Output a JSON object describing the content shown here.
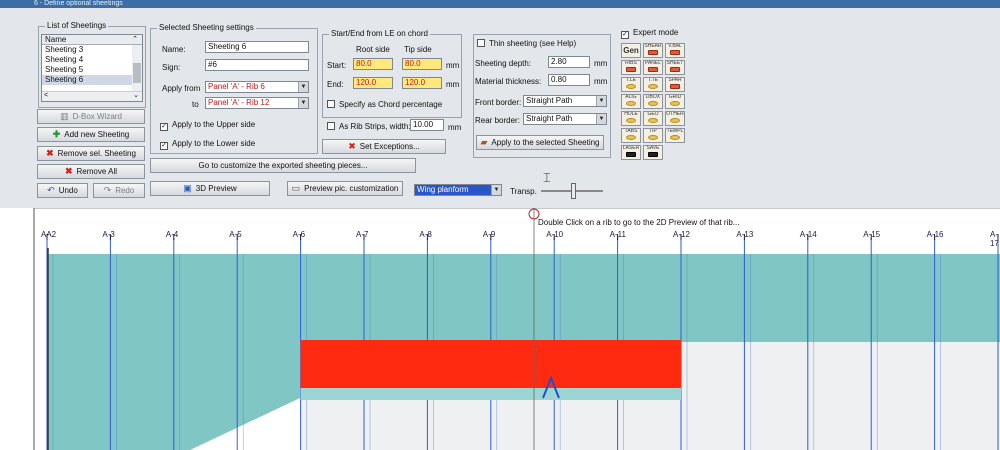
{
  "window": {
    "title": "6 - Define optional sheetings"
  },
  "list": {
    "title": "List of Sheetings",
    "header": "Name",
    "items": [
      "Sheeting 3",
      "Sheeting 4",
      "Sheeting 5",
      "Sheeting 6"
    ],
    "selected_index": 3
  },
  "left_buttons": {
    "dbox": "D-Box Wizard",
    "add": "Add new Sheeting",
    "remove_sel": "Remove sel. Sheeting",
    "remove_all": "Remove All",
    "undo": "Undo",
    "redo": "Redo"
  },
  "settings": {
    "title": "Selected Sheeting settings",
    "name_label": "Name:",
    "name_value": "Sheeting 6",
    "sign_label": "Sign:",
    "sign_value": "#6",
    "apply_from_label": "Apply from",
    "apply_from_value": "Panel 'A' - Rib 6",
    "to_label": "to",
    "to_value": "Panel 'A' - Rib 12",
    "upper_label": "Apply to the Upper side",
    "lower_label": "Apply to the Lower side"
  },
  "startend": {
    "title": "Start/End from LE on chord",
    "root_label": "Root side",
    "tip_label": "Tip side",
    "start_label": "Start:",
    "end_label": "End:",
    "start_root": "80.0",
    "start_tip": "80.0",
    "end_root": "120.0",
    "end_tip": "120.0",
    "unit": "mm",
    "chord_pct_label": "Specify as Chord percentage",
    "rib_strips_label": "As Rib Strips, width:",
    "rib_strips_value": "10.00",
    "rib_strips_unit": "mm",
    "set_exceptions": "Set Exceptions..."
  },
  "thin": {
    "thin_label": "Thin sheeting (see Help)",
    "depth_label": "Sheeting depth:",
    "depth_value": "2.80",
    "thickness_label": "Material thickness:",
    "thickness_value": "0.80",
    "unit": "mm",
    "front_label": "Front border:",
    "front_value": "Straight Path",
    "rear_label": "Rear border:",
    "rear_value": "Straight Path",
    "apply_button": "Apply to the selected Sheeting"
  },
  "expert": {
    "label": "Expert mode",
    "tools": [
      {
        "caption": "Gen",
        "kind": "gen"
      },
      {
        "caption": "SHEAR",
        "kind": "red"
      },
      {
        "caption": "V.BAL",
        "kind": "red"
      },
      {
        "caption": "RIBS",
        "kind": "red"
      },
      {
        "caption": "PANEL",
        "kind": "red"
      },
      {
        "caption": "SHEET",
        "kind": "red"
      },
      {
        "caption": "T.LE",
        "kind": "yellow"
      },
      {
        "caption": "T.TE",
        "kind": "yellow"
      },
      {
        "caption": "SPAR",
        "kind": "red"
      },
      {
        "caption": "ALIG",
        "kind": "yellow"
      },
      {
        "caption": "DBOX",
        "kind": "yellow"
      },
      {
        "caption": "GRID",
        "kind": "yellow"
      },
      {
        "caption": "HOLE",
        "kind": "yellow"
      },
      {
        "caption": "GEO",
        "kind": "yellow"
      },
      {
        "caption": "OTHER",
        "kind": "yellow"
      },
      {
        "caption": "TABS",
        "kind": "yellow"
      },
      {
        "caption": "TIP",
        "kind": "yellow"
      },
      {
        "caption": "TEMPL",
        "kind": "yellow"
      },
      {
        "caption": "LASER",
        "kind": "blk"
      },
      {
        "caption": "SAVE",
        "kind": "blk"
      }
    ]
  },
  "bottom": {
    "customize": "Go to customize the exported sheeting pieces...",
    "preview3d": "3D Preview",
    "preview_pic": "Preview pic. customization",
    "view_select": "Wing planform",
    "transp_label": "Transp."
  },
  "canvas": {
    "hint": "Double Click on a rib to go to the 2D Preview of that rib...",
    "ribs": [
      "AA2",
      "A-3",
      "A-4",
      "A-5",
      "A-6",
      "A-7",
      "A-8",
      "A-9",
      "A-10",
      "A-11",
      "A-12",
      "A-13",
      "A-14",
      "A-15",
      "A-16",
      "A-17"
    ]
  },
  "colors": {
    "panel_bg": "#e3e6ea",
    "wing_fill": "#7fc6c4",
    "rib_line": "#2f5bd6",
    "sheet_fill": "#ff2a10",
    "sheet_strip": "#9bd6d4"
  }
}
